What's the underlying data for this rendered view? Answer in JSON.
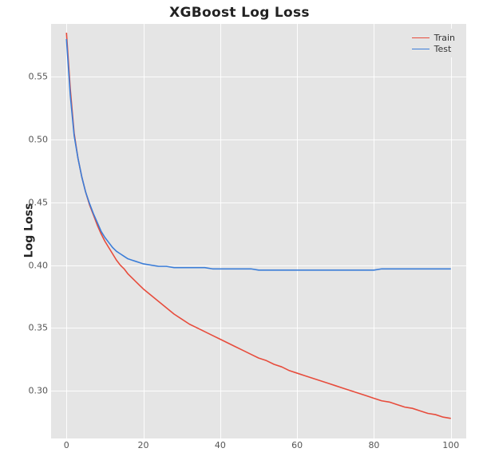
{
  "chart_data": {
    "type": "line",
    "title": "XGBoost Log Loss",
    "xlabel": "",
    "ylabel": "Log Loss",
    "xlim": [
      -4,
      104
    ],
    "ylim": [
      0.262,
      0.592
    ],
    "xticks": [
      0,
      20,
      40,
      60,
      80,
      100
    ],
    "yticks": [
      0.3,
      0.35,
      0.4,
      0.45,
      0.5,
      0.55
    ],
    "ytick_labels": [
      "0.30",
      "0.35",
      "0.40",
      "0.45",
      "0.50",
      "0.55"
    ],
    "x": [
      0,
      1,
      2,
      3,
      4,
      5,
      6,
      7,
      8,
      9,
      10,
      11,
      12,
      13,
      14,
      15,
      16,
      17,
      18,
      19,
      20,
      22,
      24,
      26,
      28,
      30,
      32,
      34,
      36,
      38,
      40,
      42,
      44,
      46,
      48,
      50,
      52,
      54,
      56,
      58,
      60,
      62,
      64,
      66,
      68,
      70,
      72,
      74,
      76,
      78,
      80,
      82,
      84,
      86,
      88,
      90,
      92,
      94,
      96,
      98,
      100
    ],
    "series": [
      {
        "name": "Train",
        "color": "#e74c3c",
        "values": [
          0.585,
          0.54,
          0.505,
          0.485,
          0.47,
          0.458,
          0.448,
          0.44,
          0.432,
          0.425,
          0.419,
          0.414,
          0.409,
          0.404,
          0.4,
          0.397,
          0.393,
          0.39,
          0.387,
          0.384,
          0.381,
          0.376,
          0.371,
          0.366,
          0.361,
          0.357,
          0.353,
          0.35,
          0.347,
          0.344,
          0.341,
          0.338,
          0.335,
          0.332,
          0.329,
          0.326,
          0.324,
          0.321,
          0.319,
          0.316,
          0.314,
          0.312,
          0.31,
          0.308,
          0.306,
          0.304,
          0.302,
          0.3,
          0.298,
          0.296,
          0.294,
          0.292,
          0.291,
          0.289,
          0.287,
          0.286,
          0.284,
          0.282,
          0.281,
          0.279,
          0.278
        ]
      },
      {
        "name": "Test",
        "color": "#3b7dd8",
        "values": [
          0.58,
          0.535,
          0.503,
          0.485,
          0.47,
          0.458,
          0.449,
          0.441,
          0.434,
          0.427,
          0.422,
          0.418,
          0.414,
          0.411,
          0.409,
          0.407,
          0.405,
          0.404,
          0.403,
          0.402,
          0.401,
          0.4,
          0.399,
          0.399,
          0.398,
          0.398,
          0.398,
          0.398,
          0.398,
          0.397,
          0.397,
          0.397,
          0.397,
          0.397,
          0.397,
          0.396,
          0.396,
          0.396,
          0.396,
          0.396,
          0.396,
          0.396,
          0.396,
          0.396,
          0.396,
          0.396,
          0.396,
          0.396,
          0.396,
          0.396,
          0.396,
          0.397,
          0.397,
          0.397,
          0.397,
          0.397,
          0.397,
          0.397,
          0.397,
          0.397,
          0.397
        ]
      }
    ],
    "legend": {
      "position": "upper right",
      "entries": [
        "Train",
        "Test"
      ]
    }
  }
}
